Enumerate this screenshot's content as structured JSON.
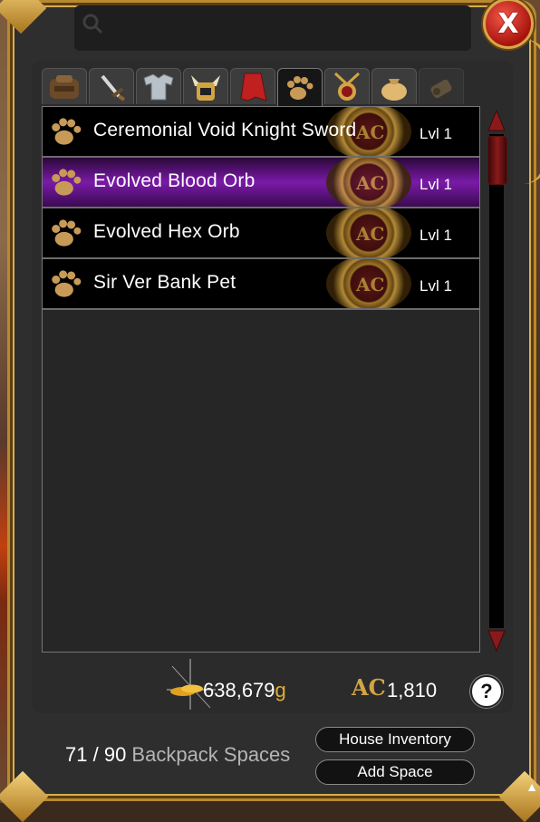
{
  "close_button": {
    "label": "X"
  },
  "search": {
    "placeholder": ""
  },
  "tabs": [
    {
      "icon": "bag-icon",
      "active": false
    },
    {
      "icon": "sword-icon",
      "active": false
    },
    {
      "icon": "armor-icon",
      "active": false
    },
    {
      "icon": "helm-icon",
      "active": false
    },
    {
      "icon": "cape-icon",
      "active": false
    },
    {
      "icon": "paw-icon",
      "active": true
    },
    {
      "icon": "amulet-icon",
      "active": false
    },
    {
      "icon": "item-bag-icon",
      "active": false
    },
    {
      "icon": "resource-icon",
      "active": false
    }
  ],
  "items": [
    {
      "name": "Ceremonial Void Knight Sword",
      "level": "Lvl 1",
      "selected": false,
      "currency": "AC"
    },
    {
      "name": "Evolved Blood Orb",
      "level": "Lvl 1",
      "selected": true,
      "currency": "AC"
    },
    {
      "name": "Evolved Hex Orb",
      "level": "Lvl 1",
      "selected": false,
      "currency": "AC"
    },
    {
      "name": "Sir Ver Bank Pet",
      "level": "Lvl 1",
      "selected": false,
      "currency": "AC"
    }
  ],
  "currency": {
    "gold_amount": "638,679",
    "gold_suffix": "g",
    "ac_symbol": "AC",
    "ac_amount": "1,810",
    "help_label": "?"
  },
  "backpack": {
    "used": "71",
    "separator": " / ",
    "total": "90",
    "label": " Backpack Spaces"
  },
  "buttons": {
    "house_inventory": "House Inventory",
    "add_space": "Add Space"
  },
  "colors": {
    "frame_gold": "#b8892e",
    "selected_row": "#7a1aa8",
    "gold_text": "#e0b030"
  }
}
